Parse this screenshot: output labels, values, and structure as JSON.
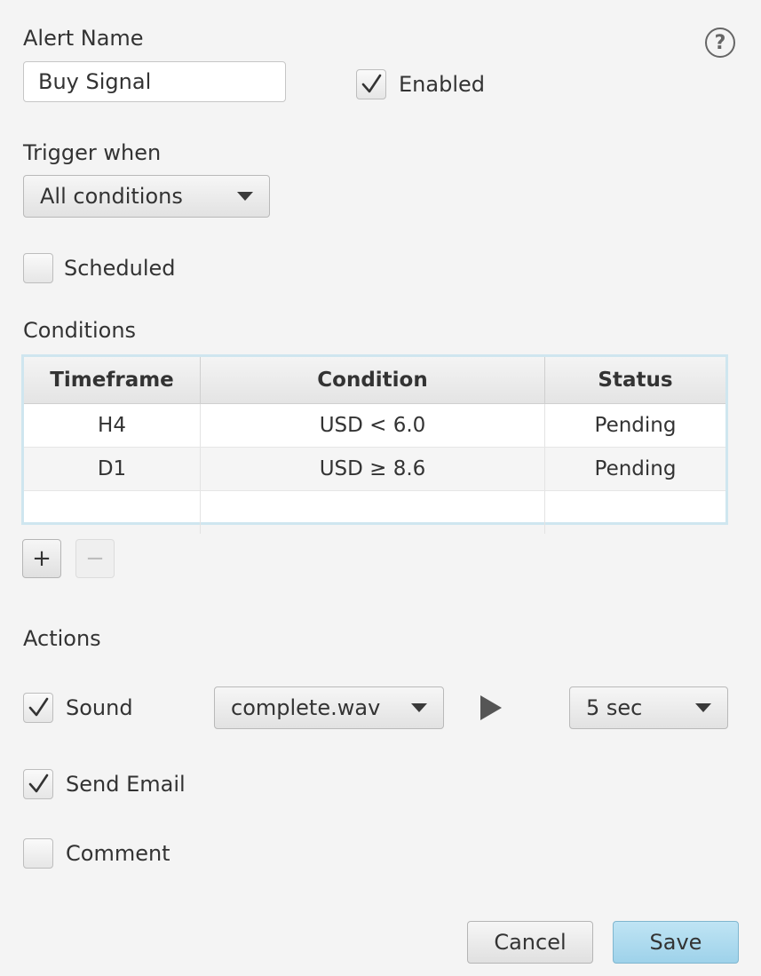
{
  "alert": {
    "name_label": "Alert Name",
    "name_value": "Buy Signal",
    "enabled_label": "Enabled",
    "enabled_checked": true
  },
  "trigger": {
    "label": "Trigger when",
    "selected": "All conditions"
  },
  "scheduled": {
    "label": "Scheduled",
    "checked": false
  },
  "conditions": {
    "label": "Conditions",
    "columns": [
      "Timeframe",
      "Condition",
      "Status"
    ],
    "rows": [
      [
        "H4",
        "USD < 6.0",
        "Pending"
      ],
      [
        "D1",
        "USD ≥ 8.6",
        "Pending"
      ]
    ],
    "add_label": "+",
    "remove_label": "−"
  },
  "actions": {
    "label": "Actions",
    "sound": {
      "label": "Sound",
      "checked": true,
      "file": "complete.wav",
      "duration": "5 sec"
    },
    "email": {
      "label": "Send Email",
      "checked": true
    },
    "comment": {
      "label": "Comment",
      "checked": false
    }
  },
  "footer": {
    "cancel_label": "Cancel",
    "save_label": "Save"
  },
  "colors": {
    "accent": "#9ed2ea",
    "table_border": "#cfe6ef"
  }
}
